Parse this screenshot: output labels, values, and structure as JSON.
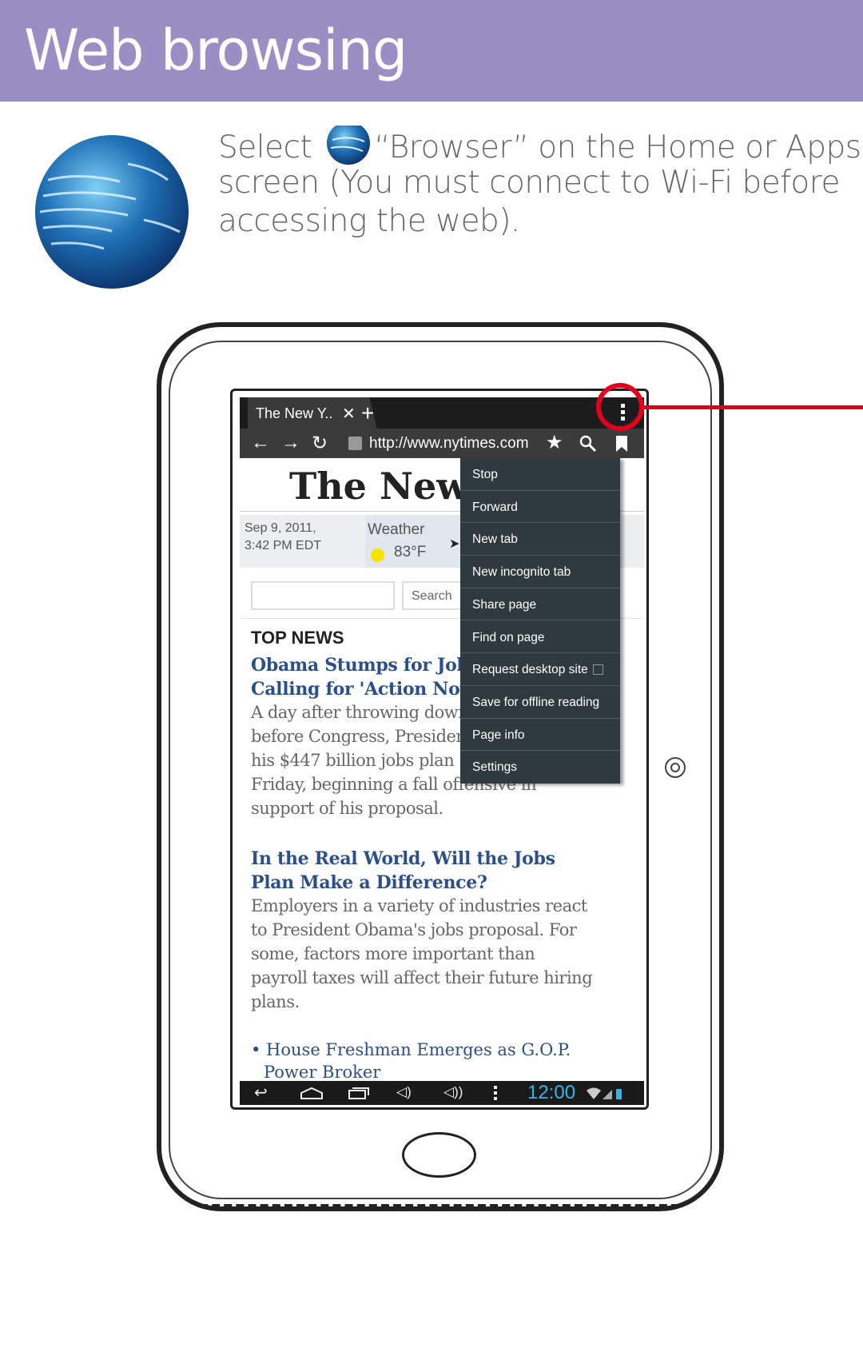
{
  "header": {
    "title": "Web browsing",
    "bg": "#9b8ec4"
  },
  "intro": {
    "line1_a": "Select",
    "line1_b": "“Browser” on the Home or Apps",
    "line2": "screen (You must connect to Wi-Fi before",
    "line3": "accessing the web)."
  },
  "browser": {
    "tab_title": "The New Y..",
    "tab_close": "✕",
    "new_tab": "+",
    "menu_icon": "overflow-menu-icon",
    "url": "http://www.nytimes.com",
    "menu": [
      "Stop",
      "Forward",
      "New tab",
      "New incognito tab",
      "Share page",
      "Find on page",
      "Request desktop site",
      "Save for offline reading",
      "Page info",
      "Settings"
    ],
    "status_time": "12:00"
  },
  "page": {
    "masthead": "The New York",
    "date1": "Sep 9, 2011,",
    "date2": "3:42 PM EDT",
    "weather_label": "Weather",
    "temp": "83°F",
    "search_button": "Search",
    "section": "TOP NEWS",
    "story1": {
      "h1": "Obama Stumps for Jobs",
      "h2": "Calling for 'Action Now",
      "b": [
        "A day after throwing down",
        "before Congress, President",
        "his $447 billion jobs plan",
        "Friday, beginning a fall offensive in",
        "support of his proposal."
      ]
    },
    "story2": {
      "h1": "In the Real World, Will the Jobs",
      "h2": "Plan Make a Difference?",
      "b": [
        "Employers in a variety of industries react",
        "to President Obama's jobs proposal. For",
        "some, factors more important than",
        "payroll taxes will affect their future hiring",
        "plans."
      ]
    },
    "bullet1": "• House Freshman Emerges as G.O.P.",
    "bullet1b": "Power Broker"
  },
  "colors": {
    "highlight": "#e3001b",
    "link": "#2b4f8a",
    "clock": "#33b5e5"
  }
}
